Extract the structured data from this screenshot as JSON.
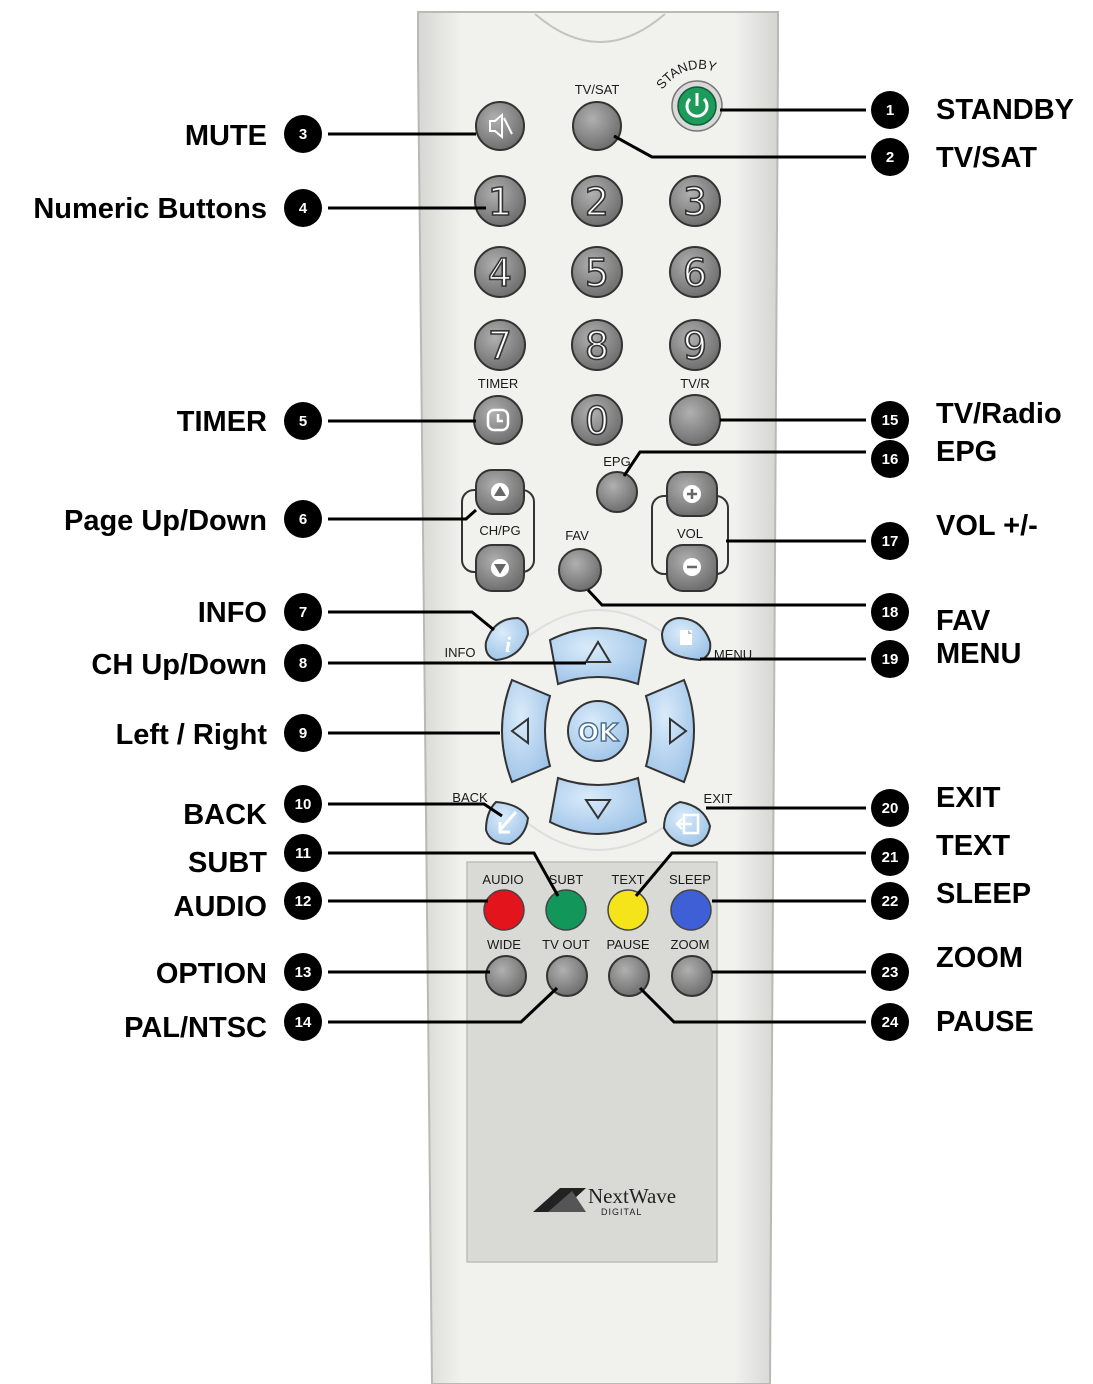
{
  "remote": {
    "standby_top_text": "STANDBY",
    "button_labels": {
      "tv_sat": "TV/SAT",
      "timer": "TIMER",
      "tv_r": "TV/R",
      "epg": "EPG",
      "ch_pg": "CH/PG",
      "vol": "VOL",
      "fav": "FAV",
      "info": "INFO",
      "menu": "MENU",
      "back": "BACK",
      "exit": "EXIT",
      "audio": "AUDIO",
      "subt": "SUBT",
      "text": "TEXT",
      "sleep": "SLEEP",
      "wide": "WIDE",
      "tv_out": "TV OUT",
      "pause": "PAUSE",
      "zoom": "ZOOM",
      "ok": "OK"
    },
    "digits": [
      "1",
      "2",
      "3",
      "4",
      "5",
      "6",
      "7",
      "8",
      "9",
      "0"
    ],
    "brand": {
      "name": "NextWave",
      "sub": "DIGITAL"
    },
    "colors": {
      "standby": "#1e9a5a",
      "red": "#e3141b",
      "green": "#13965a",
      "yellow": "#f5e41a",
      "blue": "#3f5fd6",
      "nav": "#b7d6f2",
      "gray_button": "#8b8b8b",
      "body": "#ececea"
    }
  },
  "callouts": {
    "left": [
      {
        "num": "3",
        "label": "MUTE"
      },
      {
        "num": "4",
        "label": "Numeric Buttons"
      },
      {
        "num": "5",
        "label": "TIMER"
      },
      {
        "num": "6",
        "label": "Page Up/Down"
      },
      {
        "num": "7",
        "label": "INFO"
      },
      {
        "num": "8",
        "label": "CH Up/Down"
      },
      {
        "num": "9",
        "label": "Left / Right"
      },
      {
        "num": "10",
        "label": "BACK"
      },
      {
        "num": "11",
        "label": "SUBT"
      },
      {
        "num": "12",
        "label": "AUDIO"
      },
      {
        "num": "13",
        "label": "OPTION"
      },
      {
        "num": "14",
        "label": "PAL/NTSC"
      }
    ],
    "right": [
      {
        "num": "1",
        "label": "STANDBY"
      },
      {
        "num": "2",
        "label": "TV/SAT"
      },
      {
        "num": "15",
        "label": "TV/Radio"
      },
      {
        "num": "16",
        "label": "EPG"
      },
      {
        "num": "17",
        "label": "VOL +/-"
      },
      {
        "num": "18",
        "label": "FAV"
      },
      {
        "num": "19",
        "label": "MENU"
      },
      {
        "num": "20",
        "label": "EXIT"
      },
      {
        "num": "21",
        "label": "TEXT"
      },
      {
        "num": "22",
        "label": "SLEEP"
      },
      {
        "num": "23",
        "label": "ZOOM"
      },
      {
        "num": "24",
        "label": "PAUSE"
      }
    ]
  }
}
